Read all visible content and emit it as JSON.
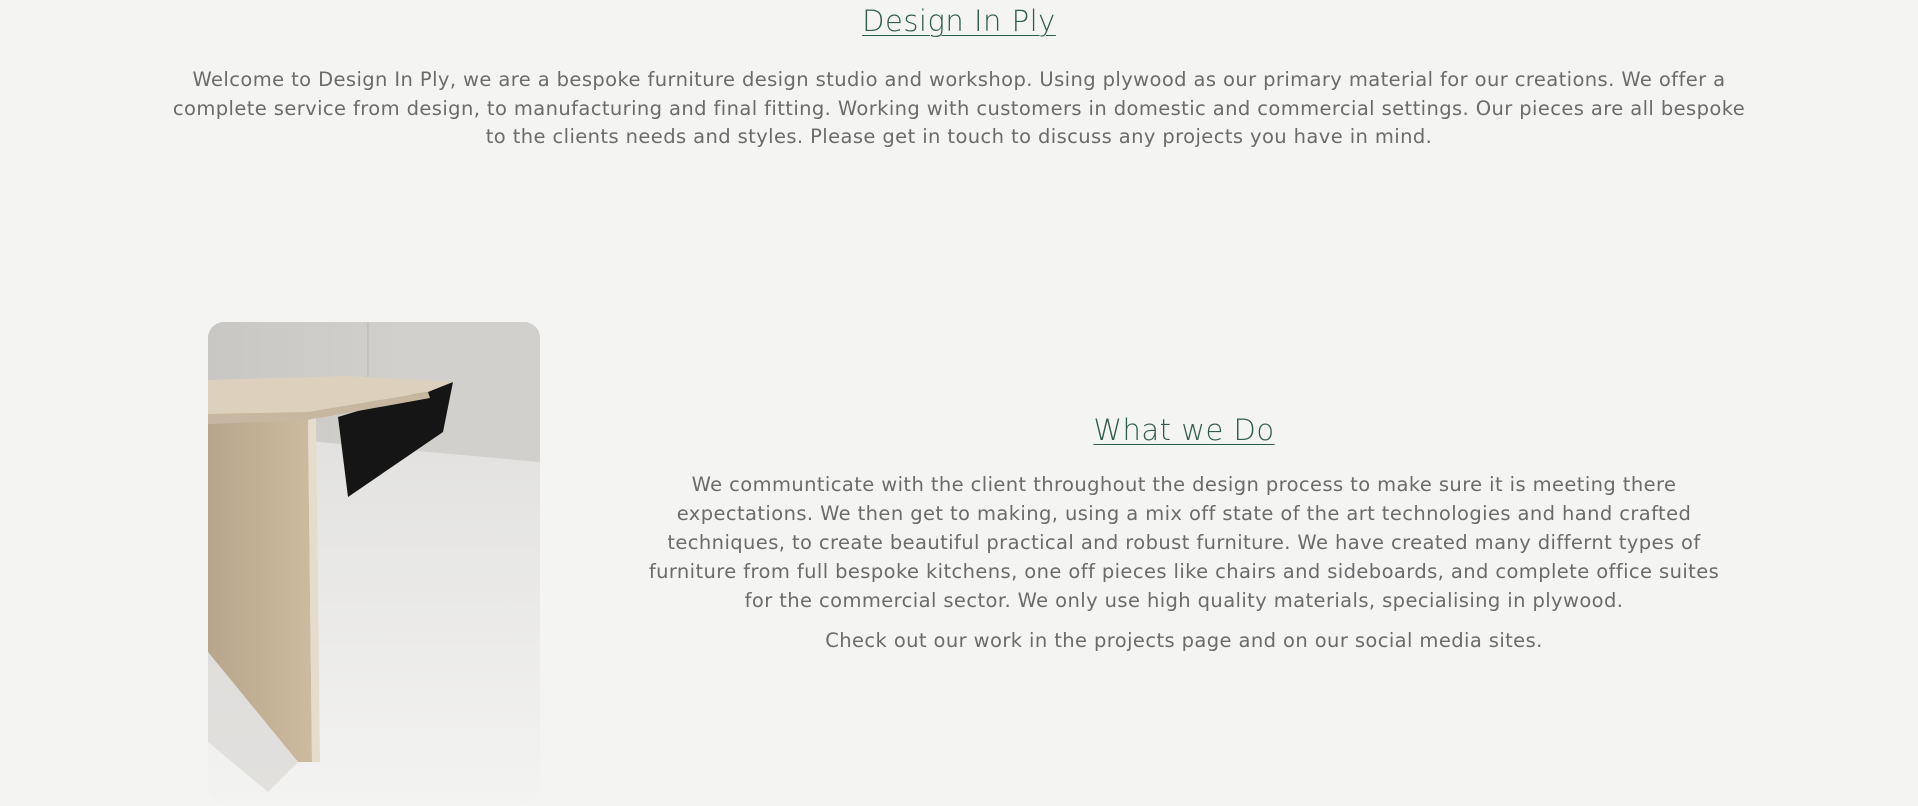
{
  "header": {
    "title": "Design In Ply"
  },
  "intro": {
    "text": "Welcome to Design In Ply, we are a bespoke furniture design studio and workshop. Using plywood as our primary material for our creations. We offer a complete service from design, to manufacturing and final fitting. Working with customers in domestic and commercial settings. Our pieces are all bespoke to the clients needs and styles. Please get in touch to discuss any projects you have in mind."
  },
  "what_we_do": {
    "title": "What we Do",
    "body": "We communticate with the client throughout the design process to make sure it is meeting there expectations. We then get to making, using a mix off state of the art technologies and hand crafted techniques, to create beautiful practical and robust furniture. We have created many differnt types of furniture from full bespoke kitchens, one off pieces like chairs and sideboards, and complete office suites for the commercial sector. We only use high quality materials, specialising in plywood.",
    "cta": "Check out our work in the projects page and on our social media sites."
  },
  "colors": {
    "background": "#f4f4f3",
    "heading": "#2e5d4b",
    "body_text": "#6b6b6b"
  }
}
